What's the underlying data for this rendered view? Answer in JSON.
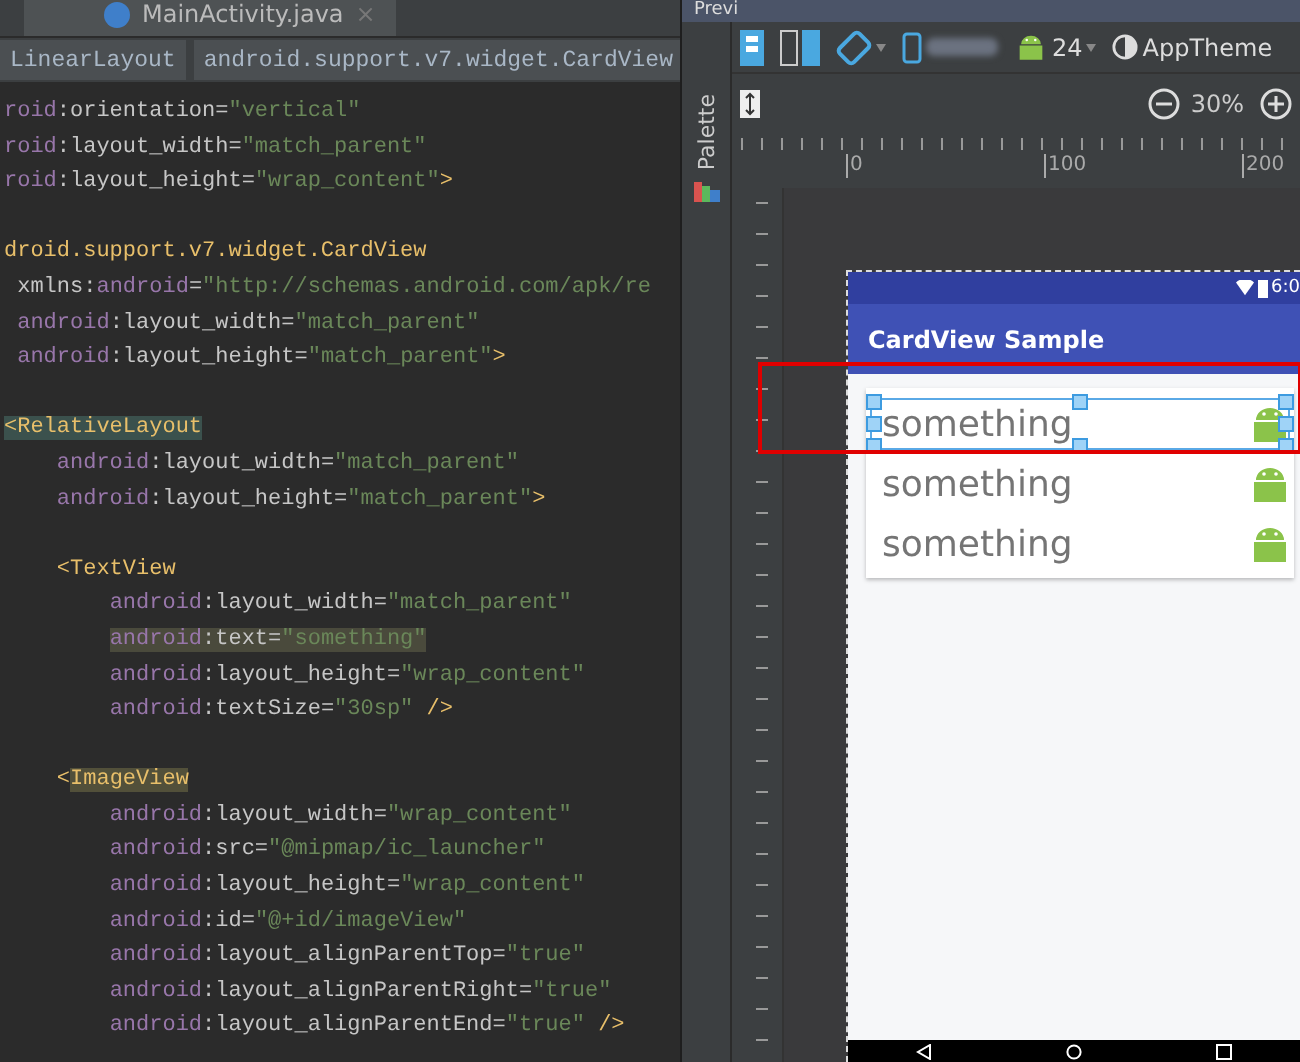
{
  "editor": {
    "tab": {
      "label": "MainActivity.java",
      "close": "×"
    },
    "breadcrumbs": [
      {
        "label": "LinearLayout"
      },
      {
        "label": "android.support.v7.widget.CardView"
      }
    ],
    "lines": [
      {
        "segments": [
          {
            "text": "roid",
            "kind": "ns"
          },
          {
            "text": ":orientation=",
            "kind": "attr"
          },
          {
            "text": "\"vertical\"",
            "kind": "str"
          }
        ]
      },
      {
        "segments": [
          {
            "text": "roid",
            "kind": "ns"
          },
          {
            "text": ":layout_width=",
            "kind": "attr"
          },
          {
            "text": "\"match_parent\"",
            "kind": "str"
          }
        ]
      },
      {
        "segments": [
          {
            "text": "roid",
            "kind": "ns"
          },
          {
            "text": ":layout_height=",
            "kind": "attr"
          },
          {
            "text": "\"wrap_content\"",
            "kind": "str"
          },
          {
            "text": ">",
            "kind": "tag"
          }
        ]
      },
      {
        "kind": "blank"
      },
      {
        "segments": [
          {
            "text": "droid.support.v7.widget.CardView",
            "kind": "tag"
          }
        ]
      },
      {
        "segments": [
          {
            "text": " xmlns:",
            "kind": "attr"
          },
          {
            "text": "android",
            "kind": "ns"
          },
          {
            "text": "=",
            "kind": "attr"
          },
          {
            "text": "\"http://schemas.android.com/apk/re",
            "kind": "str"
          }
        ]
      },
      {
        "segments": [
          {
            "text": " android",
            "kind": "ns"
          },
          {
            "text": ":layout_width=",
            "kind": "attr"
          },
          {
            "text": "\"match_parent\"",
            "kind": "str"
          }
        ]
      },
      {
        "segments": [
          {
            "text": " android",
            "kind": "ns"
          },
          {
            "text": ":layout_height=",
            "kind": "attr"
          },
          {
            "text": "\"match_parent\"",
            "kind": "str"
          },
          {
            "text": ">",
            "kind": "tag"
          }
        ]
      },
      {
        "kind": "blank"
      },
      {
        "segments": [
          {
            "text": "<RelativeLayout",
            "kind": "match"
          }
        ]
      },
      {
        "segments": [
          {
            "text": "    android",
            "kind": "ns"
          },
          {
            "text": ":layout_width=",
            "kind": "attr"
          },
          {
            "text": "\"match_parent\"",
            "kind": "str"
          }
        ]
      },
      {
        "segments": [
          {
            "text": "    android",
            "kind": "ns"
          },
          {
            "text": ":layout_height=",
            "kind": "attr"
          },
          {
            "text": "\"match_parent\"",
            "kind": "str"
          },
          {
            "text": ">",
            "kind": "tag"
          }
        ]
      },
      {
        "kind": "blank"
      },
      {
        "segments": [
          {
            "text": "    <TextView",
            "kind": "tag"
          }
        ]
      },
      {
        "segments": [
          {
            "text": "        android",
            "kind": "ns"
          },
          {
            "text": ":layout_width=",
            "kind": "attr"
          },
          {
            "text": "\"match_parent\"",
            "kind": "str"
          }
        ]
      },
      {
        "segments": [
          {
            "text": "        android",
            "kind": "hl-ns"
          },
          {
            "text": ":text=",
            "kind": "hl-attr"
          },
          {
            "text": "\"something\"",
            "kind": "hl-str"
          }
        ]
      },
      {
        "segments": [
          {
            "text": "        android",
            "kind": "ns"
          },
          {
            "text": ":layout_height=",
            "kind": "attr"
          },
          {
            "text": "\"wrap_content\"",
            "kind": "str"
          }
        ]
      },
      {
        "segments": [
          {
            "text": "        android",
            "kind": "ns"
          },
          {
            "text": ":textSize=",
            "kind": "attr"
          },
          {
            "text": "\"30sp\"",
            "kind": "str"
          },
          {
            "text": " />",
            "kind": "tag"
          }
        ]
      },
      {
        "kind": "blank"
      },
      {
        "segments": [
          {
            "text": "    <",
            "kind": "tag"
          },
          {
            "text": "ImageView",
            "kind": "match"
          }
        ]
      },
      {
        "segments": [
          {
            "text": "        android",
            "kind": "ns"
          },
          {
            "text": ":layout_width=",
            "kind": "attr"
          },
          {
            "text": "\"wrap_content\"",
            "kind": "str"
          }
        ]
      },
      {
        "segments": [
          {
            "text": "        android",
            "kind": "ns"
          },
          {
            "text": ":src=",
            "kind": "attr"
          },
          {
            "text": "\"@mipmap/ic_launcher\"",
            "kind": "str"
          }
        ]
      },
      {
        "segments": [
          {
            "text": "        android",
            "kind": "ns"
          },
          {
            "text": ":layout_height=",
            "kind": "attr"
          },
          {
            "text": "\"wrap_content\"",
            "kind": "str"
          }
        ]
      },
      {
        "segments": [
          {
            "text": "        android",
            "kind": "ns"
          },
          {
            "text": ":id=",
            "kind": "attr"
          },
          {
            "text": "\"@+id/imageView\"",
            "kind": "str"
          }
        ]
      },
      {
        "segments": [
          {
            "text": "        android",
            "kind": "ns"
          },
          {
            "text": ":layout_alignParentTop=",
            "kind": "attr"
          },
          {
            "text": "\"true\"",
            "kind": "str"
          }
        ]
      },
      {
        "segments": [
          {
            "text": "        android",
            "kind": "ns"
          },
          {
            "text": ":layout_alignParentRight=",
            "kind": "attr"
          },
          {
            "text": "\"true\"",
            "kind": "str"
          }
        ]
      },
      {
        "segments": [
          {
            "text": "        android",
            "kind": "ns"
          },
          {
            "text": ":layout_alignParentEnd=",
            "kind": "attr"
          },
          {
            "text": "\"true\"",
            "kind": "str"
          },
          {
            "text": " />",
            "kind": "tag"
          }
        ]
      }
    ]
  },
  "preview": {
    "title": "Previ",
    "palette_label": "Palette",
    "api_level": "24",
    "theme": "AppTheme",
    "zoom": "30%",
    "ruler_labels": [
      "0",
      "100",
      "200"
    ],
    "device": {
      "time": "6:0",
      "app_title": "CardView Sample",
      "items": [
        {
          "text": "something",
          "selected": true
        },
        {
          "text": "something",
          "selected": false
        },
        {
          "text": "something",
          "selected": false
        }
      ]
    }
  }
}
